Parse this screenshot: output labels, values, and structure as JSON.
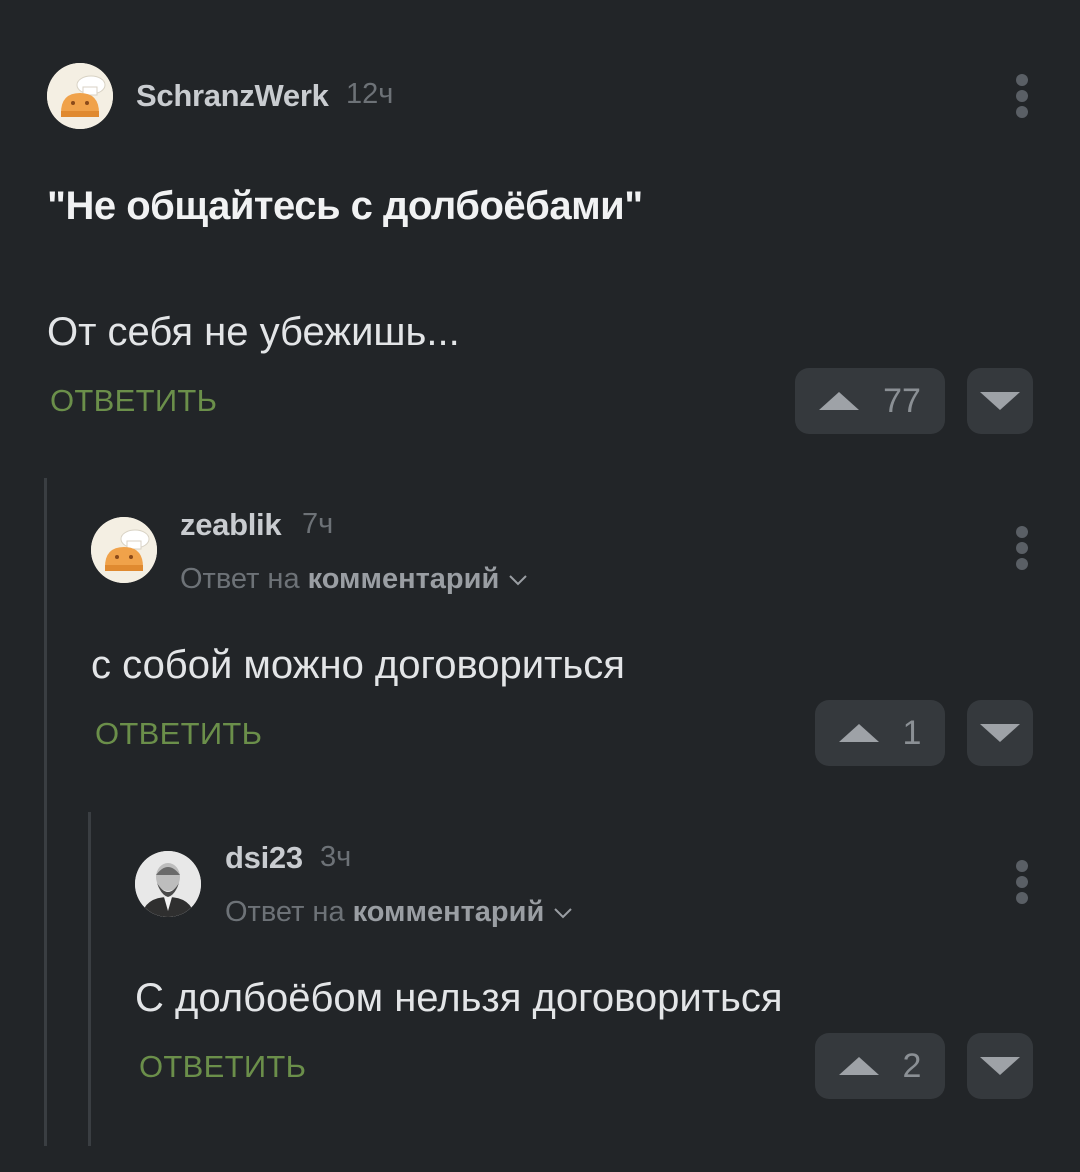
{
  "comments": [
    {
      "username": "SchranzWerk",
      "time": "12ч",
      "title": "\"Не общайтесь с долбоёбами\"",
      "text": "От себя не убежишь...",
      "reply_label": "ОТВЕТИТЬ",
      "rating": "77"
    },
    {
      "username": "zeablik",
      "time": "7ч",
      "reply_prefix": "Ответ на",
      "reply_target": "комментарий",
      "text": "с собой можно договориться",
      "reply_label": "ОТВЕТИТЬ",
      "rating": "1"
    },
    {
      "username": "dsi23",
      "time": "3ч",
      "reply_prefix": "Ответ на",
      "reply_target": "комментарий",
      "text": "С долбоёбом нельзя договориться",
      "reply_label": "ОТВЕТИТЬ",
      "rating": "2"
    }
  ],
  "colors": {
    "background": "#222528",
    "reply_green": "#6b8f4a",
    "vote_button": "#35393d"
  },
  "icons": [
    "more-vertical-icon",
    "upvote-arrow-icon",
    "downvote-arrow-icon",
    "chevron-down-icon"
  ]
}
